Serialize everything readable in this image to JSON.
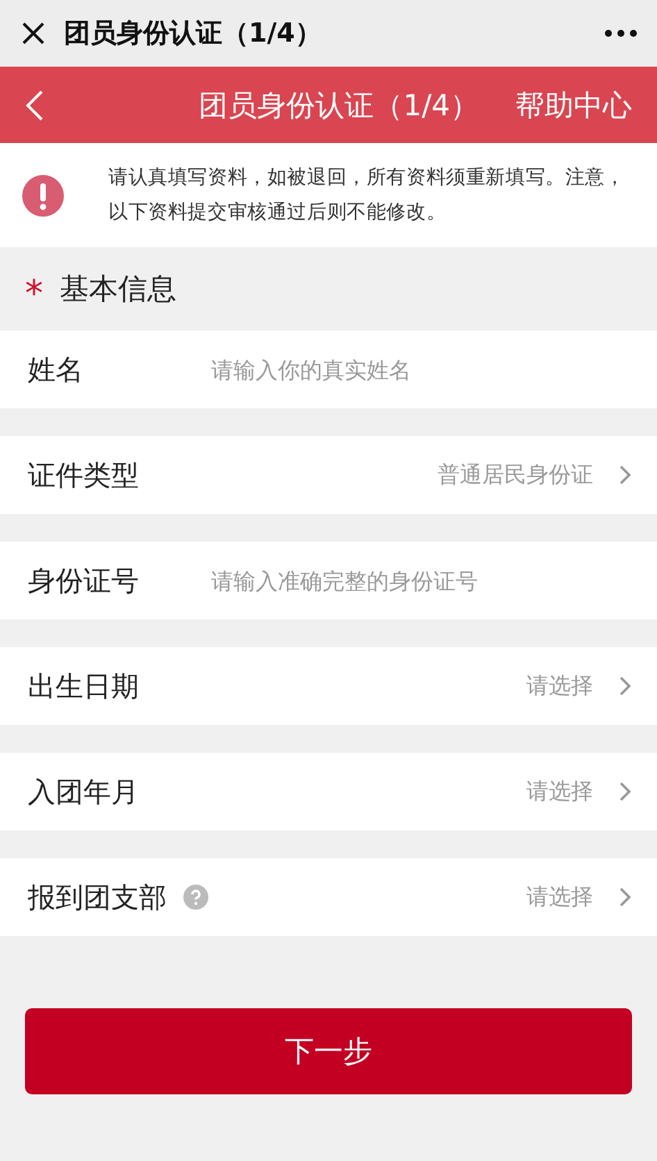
{
  "window": {
    "title": "团员身份认证（1/4）"
  },
  "header": {
    "title": "团员身份认证（1/4）",
    "action": "帮助中心"
  },
  "notice": {
    "text": "请认真填写资料，如被退回，所有资料须重新填写。注意，以下资料提交审核通过后则不能修改。"
  },
  "section": {
    "mark": "*",
    "title": "基本信息"
  },
  "rows": [
    {
      "kind": "input",
      "label": "姓名",
      "placeholder": "请输入你的真实姓名"
    },
    {
      "kind": "select",
      "label": "证件类型",
      "value": "普通居民身份证",
      "help": false
    },
    {
      "kind": "input",
      "label": "身份证号",
      "placeholder": "请输入准确完整的身份证号"
    },
    {
      "kind": "select",
      "label": "出生日期",
      "value": "请选择",
      "help": false
    },
    {
      "kind": "select",
      "label": "入团年月",
      "value": "请选择",
      "help": false
    },
    {
      "kind": "select",
      "label": "报到团支部",
      "value": "请选择",
      "help": true
    }
  ],
  "button": "下一步"
}
